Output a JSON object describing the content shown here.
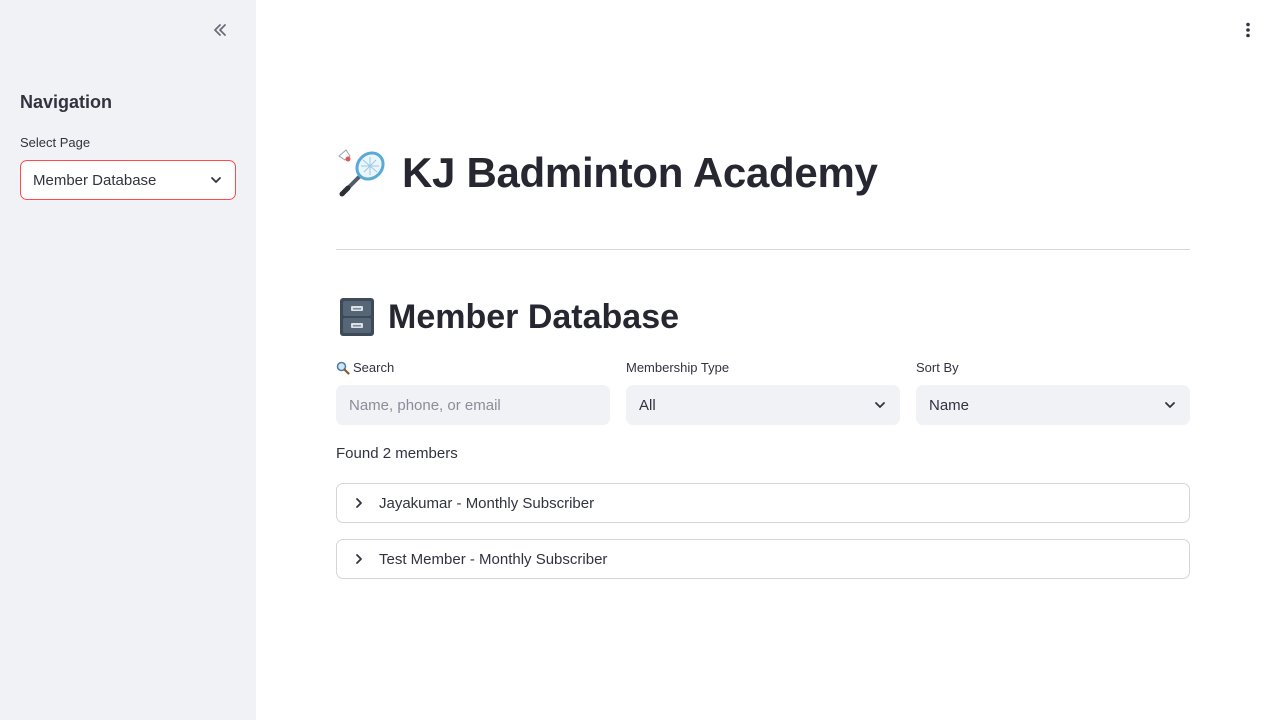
{
  "sidebar": {
    "collapse_icon": "double-chevron-left-icon",
    "nav_title": "Navigation",
    "select_label": "Select Page",
    "selected_page": "Member Database"
  },
  "header": {
    "menu_icon": "vertical-dots-icon"
  },
  "main": {
    "app_title": "KJ Badminton Academy",
    "app_icon": "badminton-icon",
    "section_title": "Member Database",
    "section_icon": "file-cabinet-icon",
    "filters": {
      "search_label": "Search",
      "search_placeholder": "Name, phone, or email",
      "membership_label": "Membership Type",
      "membership_value": "All",
      "sort_label": "Sort By",
      "sort_value": "Name"
    },
    "found_text": "Found 2 members",
    "members": [
      "Jayakumar - Monthly Subscriber",
      "Test Member - Monthly Subscriber"
    ]
  },
  "colors": {
    "accent": "#ff4b4b",
    "sidebar_bg": "#f0f2f6",
    "text": "#31333f"
  }
}
